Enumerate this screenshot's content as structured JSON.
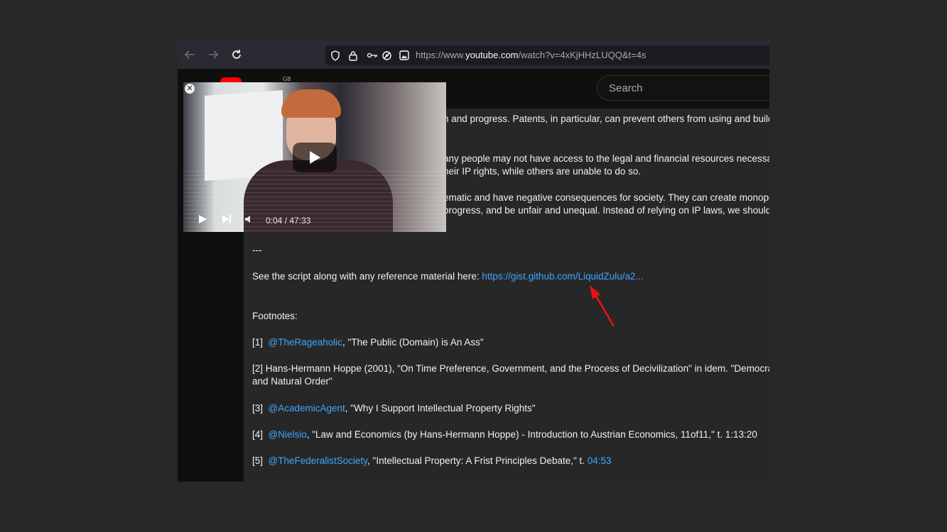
{
  "browser": {
    "url_prefix": "https://www.",
    "url_host": "youtube.com",
    "url_path": "/watch?v=4xKjHHzLUQQ&t=4s"
  },
  "youtube": {
    "search_placeholder": "Search",
    "region_code": "GB"
  },
  "miniplayer": {
    "close_label": "✕",
    "time": "0:04 / 47:33"
  },
  "description": {
    "partial_lines": [
      "n and progress. Patents, in particular, can prevent others from using and building",
      "any people may not have access to the legal and financial resources necessary t",
      "heir IP rights, while others are unable to do so.",
      "ematic and have negative consequences for society. They can create monopolie",
      "progress, and be unfair and unequal. Instead of relying on IP laws, we should co"
    ],
    "separator": "---",
    "script_text": "See the script along with any reference material here: ",
    "script_link": "https://gist.github.com/LiquidZulu/a2...",
    "footnotes_heading": "Footnotes:",
    "fn1_num": "[1]",
    "fn1_link": "@TheRageaholic",
    "fn1_text": ", \"The Public (Domain) is An Ass\"",
    "fn2_line1": "[2] Hans-Hermann Hoppe (2001), \"On Time Preference, Government, and the Process of Decivilization\" in idem. \"Democracy - Th",
    "fn2_line2": "and Natural Order\"",
    "fn3_num": "[3]",
    "fn3_link": "@AcademicAgent",
    "fn3_text": ", \"Why I Support Intellectual Property Rights\"",
    "fn4_num": "[4]",
    "fn4_link": "@Nielsio",
    "fn4_text": ", \"Law and Economics (by Hans-Hermann Hoppe) - Introduction to Austrian Economics, 11of11,\" t. 1:13:20",
    "fn5_num": "[5]",
    "fn5_link": "@TheFederalistSociety",
    "fn5_text": ", \"Intellectual Property: A Frist Principles Debate,\" t. ",
    "fn5_time": "04:53"
  },
  "colors": {
    "link": "#3ea6ff",
    "annotation_arrow": "#ee1111",
    "youtube_red": "#ff0000"
  }
}
